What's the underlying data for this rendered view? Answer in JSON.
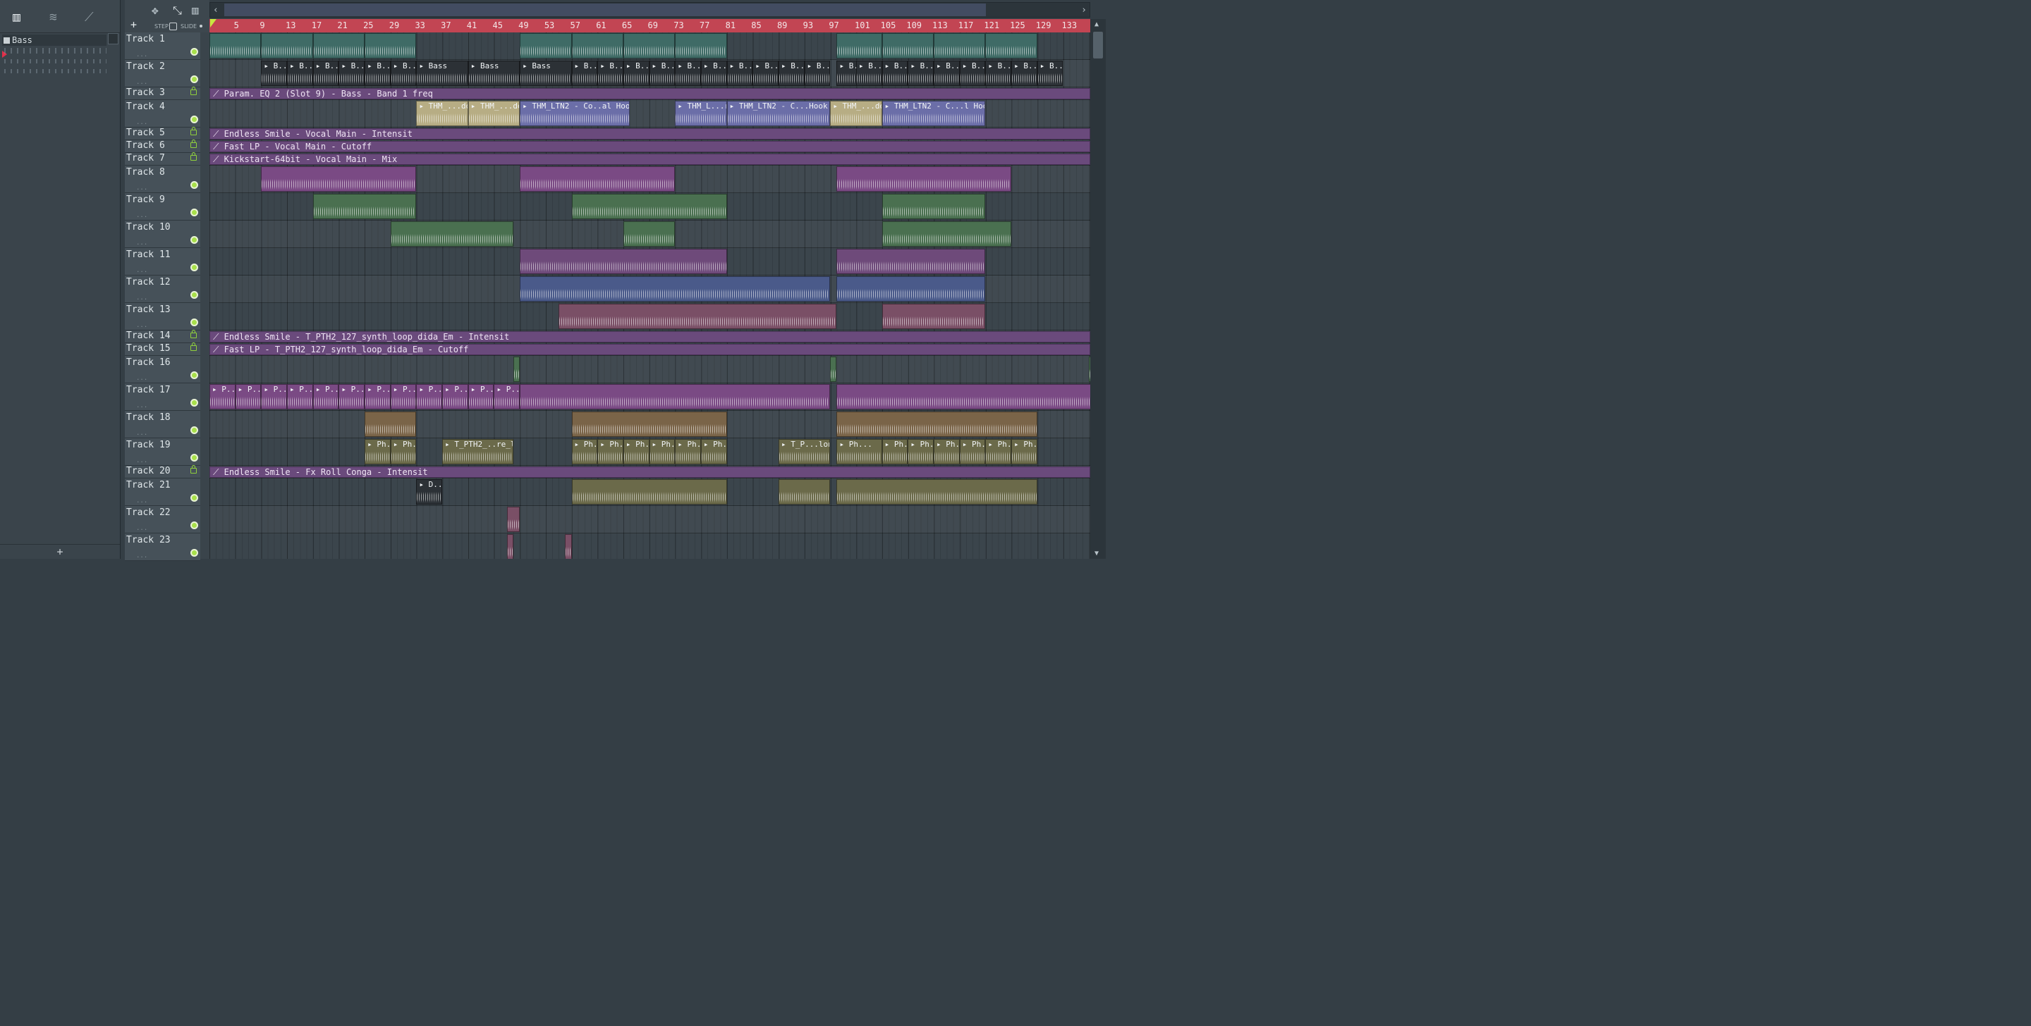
{
  "picker": {
    "selected_pattern": "Bass",
    "add_label": "+"
  },
  "toolbar": {
    "add_label": "+",
    "step_label": "STEP",
    "slide_label": "SLIDE"
  },
  "timeline": {
    "bars": [
      "5",
      "9",
      "13",
      "17",
      "21",
      "25",
      "29",
      "33",
      "37",
      "41",
      "45",
      "49",
      "53",
      "57",
      "61",
      "65",
      "69",
      "73",
      "77",
      "81",
      "85",
      "89",
      "93",
      "97",
      "101",
      "105",
      "109",
      "113",
      "117",
      "121",
      "125",
      "129",
      "133"
    ]
  },
  "tracks": [
    {
      "name": "Track 1",
      "type": "audio",
      "height": 39
    },
    {
      "name": "Track 2",
      "type": "audio",
      "height": 39
    },
    {
      "name": "Track 3",
      "type": "automation",
      "height": 18
    },
    {
      "name": "Track 4",
      "type": "audio",
      "height": 39
    },
    {
      "name": "Track 5",
      "type": "automation",
      "height": 18
    },
    {
      "name": "Track 6",
      "type": "automation",
      "height": 18
    },
    {
      "name": "Track 7",
      "type": "automation",
      "height": 18
    },
    {
      "name": "Track 8",
      "type": "audio",
      "height": 39
    },
    {
      "name": "Track 9",
      "type": "audio",
      "height": 39
    },
    {
      "name": "Track 10",
      "type": "audio",
      "height": 39
    },
    {
      "name": "Track 11",
      "type": "audio",
      "height": 39
    },
    {
      "name": "Track 12",
      "type": "audio",
      "height": 39
    },
    {
      "name": "Track 13",
      "type": "audio",
      "height": 39
    },
    {
      "name": "Track 14",
      "type": "automation",
      "height": 18
    },
    {
      "name": "Track 15",
      "type": "automation",
      "height": 18
    },
    {
      "name": "Track 16",
      "type": "audio",
      "height": 39
    },
    {
      "name": "Track 17",
      "type": "audio",
      "height": 39
    },
    {
      "name": "Track 18",
      "type": "audio",
      "height": 39
    },
    {
      "name": "Track 19",
      "type": "audio",
      "height": 39
    },
    {
      "name": "Track 20",
      "type": "automation",
      "height": 18
    },
    {
      "name": "Track 21",
      "type": "audio",
      "height": 39
    },
    {
      "name": "Track 22",
      "type": "audio",
      "height": 39
    },
    {
      "name": "Track 23",
      "type": "audio",
      "height": 39
    }
  ],
  "clips": {
    "track2": [
      "B..s",
      "B..s",
      "B..s",
      "B..s",
      "B..s",
      "B..s",
      "Bass",
      "Bass",
      "Bass",
      "B..s",
      "B..s",
      "B..s",
      "B..s",
      "B..s",
      "B..s",
      "B..s",
      "B..s",
      "B..s",
      "B..s",
      "B..s",
      "B..s",
      "B..s",
      "B..s",
      "B..s",
      "B..s",
      "B..s",
      "B..s",
      "B..s"
    ],
    "track3_auto": "Param. EQ 2 (Slot 9) - Bass - Band 1 freq",
    "track4": [
      "THM_...down",
      "THM_...down",
      "THM_LTN2 - Co..al Hook Drop",
      "THM_L...rop",
      "THM_LTN2 - C...Hook Drop",
      "THM_...down",
      "THM_LTN2 - C...l Hook Drop"
    ],
    "track5_auto": "Endless Smile - Vocal Main - Intensit",
    "track6_auto": "Fast LP - Vocal Main - Cutoff",
    "track7_auto": "Kickstart-64bit - Vocal Main - Mix",
    "track14_auto": "Endless Smile - T_PTH2_127_synth_loop_dida_Em - Intensit",
    "track15_auto": "Fast LP - T_PTH2_127_synth_loop_dida_Em - Cutoff",
    "track17": [
      "P...M",
      "P...M",
      "P...M",
      "P...M",
      "P...M",
      "P...M",
      "P...M",
      "P...M",
      "P...M",
      "P...M",
      "P...M",
      "P...M"
    ],
    "track19": [
      "Ph...",
      "Ph...",
      "T_PTH2_..re_long",
      "Ph...",
      "Ph...",
      "Ph...",
      "Ph...",
      "Ph...",
      "Ph...",
      "T_P...long",
      "Ph...",
      "Ph...",
      "Ph...",
      "Ph...",
      "Ph...",
      "Ph...",
      "Ph..."
    ],
    "track20_auto": "Endless Smile - Fx Roll Conga - Intensit",
    "track21": [
      "D...s"
    ]
  },
  "colors": {
    "ruler": "#c24553",
    "automation": "#6a4a7c",
    "teal": "#3f6b66",
    "dark": "#2c3136",
    "beige": "#b7ad84",
    "blue_purple": "#6b6ea8",
    "purple": "#6e4a7a",
    "green": "#4a7050",
    "blue": "#4a5a8a",
    "pink": "#7a4f66",
    "magenta": "#7a4a84",
    "brown": "#7a6448",
    "olive": "#6b6a4a",
    "led": "#a8e04a"
  }
}
